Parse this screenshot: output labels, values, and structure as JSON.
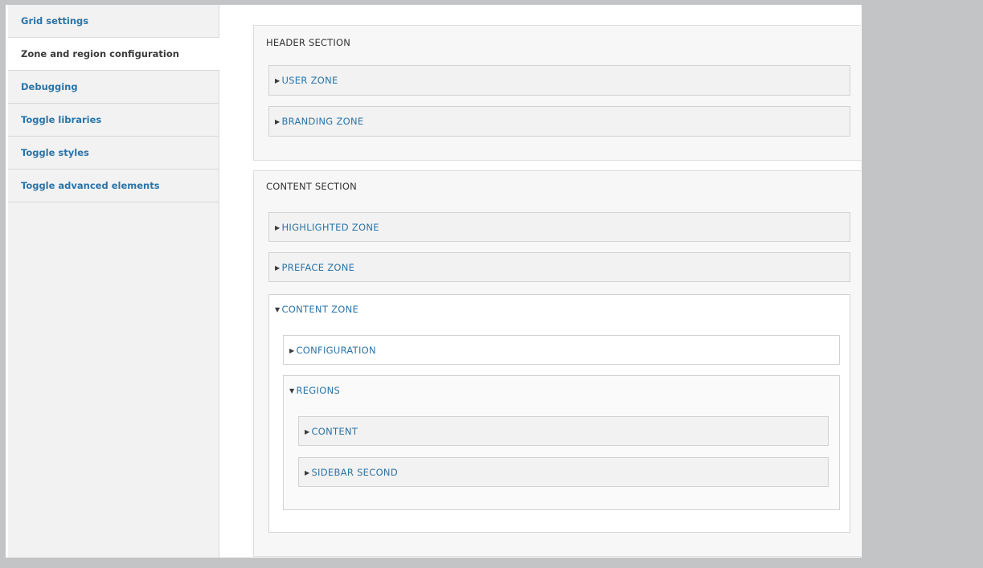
{
  "sidebar": {
    "tabs": [
      {
        "label": "Grid settings"
      },
      {
        "label": "Zone and region configuration"
      },
      {
        "label": "Debugging"
      },
      {
        "label": "Toggle libraries"
      },
      {
        "label": "Toggle styles"
      },
      {
        "label": "Toggle advanced elements"
      }
    ]
  },
  "header_section": {
    "title": "HEADER SECTION",
    "zones": [
      {
        "label": "USER ZONE",
        "icon": "triangle-right"
      },
      {
        "label": "BRANDING ZONE",
        "icon": "triangle-right"
      }
    ]
  },
  "content_section": {
    "title": "CONTENT SECTION",
    "zones": [
      {
        "label": "HIGHLIGHTED ZONE",
        "icon": "triangle-right"
      },
      {
        "label": "PREFACE ZONE",
        "icon": "triangle-right"
      }
    ],
    "content_zone": {
      "label": "CONTENT ZONE",
      "icon": "triangle-down",
      "configuration": {
        "label": "CONFIGURATION",
        "icon": "triangle-right"
      },
      "regions": {
        "label": "REGIONS",
        "icon": "triangle-down",
        "items": [
          {
            "label": "CONTENT",
            "icon": "triangle-right"
          },
          {
            "label": "SIDEBAR SECOND",
            "icon": "triangle-right"
          }
        ]
      }
    }
  },
  "colors": {
    "link": "#2a74a8",
    "outer_bg": "#c3c4c5",
    "tabs_bg": "#f2f2f2",
    "panel_bg": "#f7f7f7"
  }
}
